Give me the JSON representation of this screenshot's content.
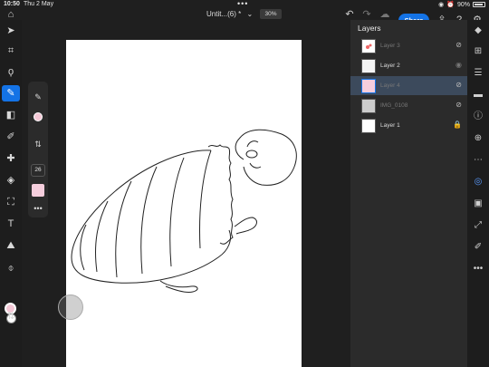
{
  "status": {
    "time": "10:50",
    "date": "Thu 2 May",
    "battery": "90%"
  },
  "header": {
    "title": "Untit...(6) *",
    "zoom": "30%",
    "share_label": "Share"
  },
  "brush": {
    "size": "26"
  },
  "colors": {
    "foreground": "#f4c8d6",
    "background": "#ffffff",
    "accent": "#1473e6"
  },
  "layers": {
    "title": "Layers",
    "items": [
      {
        "name": "Layer 3",
        "visible": false
      },
      {
        "name": "Layer 2",
        "visible": true
      },
      {
        "name": "Layer 4",
        "visible": false,
        "selected": true
      },
      {
        "name": "IMG_0108",
        "visible": false
      },
      {
        "name": "Layer 1",
        "locked": true
      }
    ]
  }
}
